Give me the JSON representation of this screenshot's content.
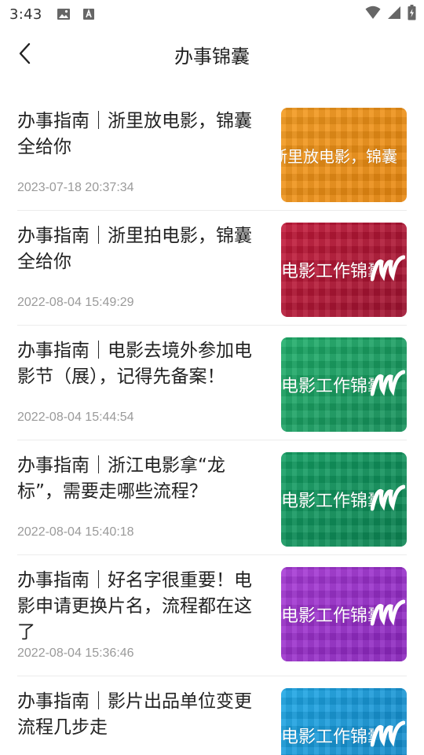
{
  "status_bar": {
    "time": "3:43",
    "icons": [
      "image-icon",
      "font-icon",
      "wifi-icon",
      "signal-icon",
      "battery-charging-icon"
    ]
  },
  "header": {
    "title": "办事锦囊",
    "back_icon": "chevron-left-icon"
  },
  "articles": [
    {
      "title": "办事指南｜浙里放电影，锦囊全给你",
      "date": "2023-07-18 20:37:34",
      "thumb_text": "浙里放电影，锦囊全给你",
      "thumb_color": "#f39a1e",
      "thumb_accent": "#e8870f"
    },
    {
      "title": "办事指南｜浙里拍电影，锦囊全给你",
      "date": "2022-08-04 15:49:29",
      "thumb_text": "电影工作锦囊",
      "thumb_color": "#c41a3a",
      "thumb_accent": "#9e1230"
    },
    {
      "title": "办事指南｜电影去境外参加电影节（展），记得先备案！",
      "date": "2022-08-04 15:44:54",
      "thumb_text": "电影工作锦囊",
      "thumb_color": "#1fae6a",
      "thumb_accent": "#14905a"
    },
    {
      "title": "办事指南｜浙江电影拿“龙标”，需要走哪些流程？",
      "date": "2022-08-04 15:40:18",
      "thumb_text": "电影工作锦囊",
      "thumb_color": "#14a064",
      "thumb_accent": "#0d8554"
    },
    {
      "title": "办事指南｜好名字很重要！电影申请更换片名，流程都在这了",
      "date": "2022-08-04 15:36:46",
      "thumb_text": "电影工作锦囊",
      "thumb_color": "#a73ad6",
      "thumb_accent": "#8a25bd"
    },
    {
      "title": "办事指南｜影片出品单位变更流程几步走",
      "date": "",
      "thumb_text": "电影工作锦囊",
      "thumb_color": "#1ea7e6",
      "thumb_accent": "#1288c8"
    }
  ]
}
